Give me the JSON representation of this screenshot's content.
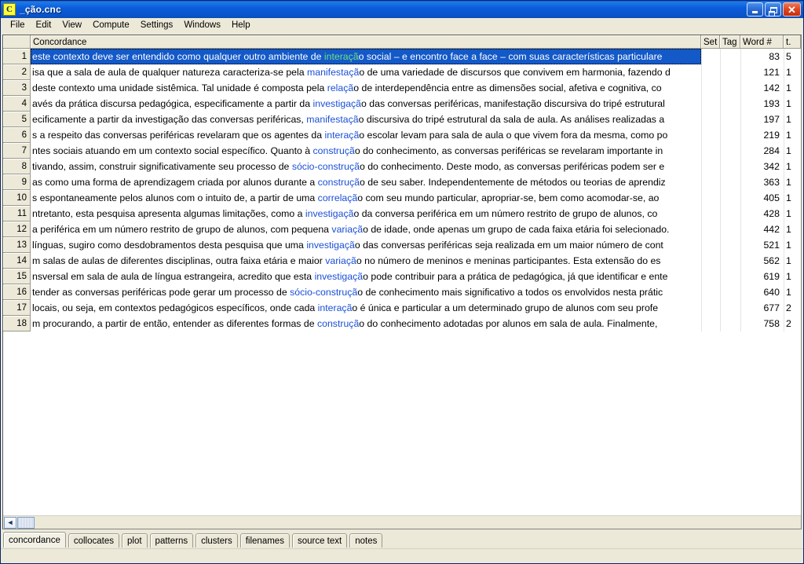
{
  "window": {
    "title": "_ção.cnc",
    "icon": "antconc-c-icon",
    "minimize_label": "",
    "restore_label": "",
    "close_label": "✕"
  },
  "menu": {
    "items": [
      {
        "label": "File"
      },
      {
        "label": "Edit"
      },
      {
        "label": "View"
      },
      {
        "label": "Compute"
      },
      {
        "label": "Settings"
      },
      {
        "label": "Windows"
      },
      {
        "label": "Help"
      }
    ]
  },
  "table": {
    "headers": {
      "index": "",
      "concordance": "Concordance",
      "set": "Set",
      "tag": "Tag",
      "word": "Word #",
      "last": "t. "
    },
    "rows": [
      {
        "index": "1",
        "pre": "este contexto deve ser entendido como qualquer outro ambiente de ",
        "kw": "interaçã",
        "post": "o social – e encontro face a face – com suas características particulare",
        "set": "",
        "tag": "",
        "word": "83",
        "last": "5",
        "selected": true
      },
      {
        "index": "2",
        "pre": "isa que a sala de aula de qualquer natureza caracteriza-se pela ",
        "kw": "manifestaçã",
        "post": "o de uma variedade de discursos que convivem em harmonia, fazendo d",
        "set": "",
        "tag": "",
        "word": "121",
        "last": "1",
        "selected": false
      },
      {
        "index": "3",
        "pre": " deste contexto uma unidade sistêmica. Tal unidade é composta pela ",
        "kw": "relaçã",
        "post": "o de interdependência entre as dimensões social, afetiva e cognitiva, co",
        "set": "",
        "tag": "",
        "word": "142",
        "last": "1",
        "selected": false
      },
      {
        "index": "4",
        "pre": "avés da prática discursa pedagógica, especificamente a partir da ",
        "kw": "investigaçã",
        "post": "o das conversas periféricas, manifestação discursiva do tripé estrutural",
        "set": "",
        "tag": "",
        "word": "193",
        "last": "1",
        "selected": false
      },
      {
        "index": "5",
        "pre": "ecificamente a partir da investigação das conversas periféricas, ",
        "kw": "manifestaçã",
        "post": "o discursiva do tripé estrutural da sala de aula. As análises realizadas a",
        "set": "",
        "tag": "",
        "word": "197",
        "last": "1",
        "selected": false
      },
      {
        "index": "6",
        "pre": " s a respeito das conversas periféricas revelaram que os agentes da ",
        "kw": "interaçã",
        "post": "o escolar levam para sala de aula o que vivem fora da mesma, como po",
        "set": "",
        "tag": "",
        "word": "219",
        "last": "1",
        "selected": false
      },
      {
        "index": "7",
        "pre": "ntes sociais atuando em um contexto social específico. Quanto à ",
        "kw": "construçã",
        "post": "o do conhecimento, as conversas periféricas se revelaram importante in",
        "set": "",
        "tag": "",
        "word": "284",
        "last": "1",
        "selected": false
      },
      {
        "index": "8",
        "pre": "tivando, assim, construir significativamente seu processo de ",
        "kw": "sócio-construçã",
        "post": "o do conhecimento. Deste modo, as conversas periféricas podem ser e",
        "set": "",
        "tag": "",
        "word": "342",
        "last": "1",
        "selected": false
      },
      {
        "index": "9",
        "pre": "as como uma forma de aprendizagem criada por alunos durante a ",
        "kw": "construçã",
        "post": "o de seu saber. Independentemente de métodos ou teorias de aprendiz",
        "set": "",
        "tag": "",
        "word": "363",
        "last": "1",
        "selected": false
      },
      {
        "index": "10",
        "pre": "s espontaneamente pelos alunos com o intuito de, a partir de uma ",
        "kw": "correlaçã",
        "post": "o com seu mundo particular, apropriar-se, bem como acomodar-se, ao",
        "set": "",
        "tag": "",
        "word": "405",
        "last": "1",
        "selected": false
      },
      {
        "index": "11",
        "pre": " ntretanto, esta pesquisa apresenta algumas limitações, como a ",
        "kw": "investigaçã",
        "post": "o da conversa periférica em um número restrito de grupo de alunos, co",
        "set": "",
        "tag": "",
        "word": "428",
        "last": "1",
        "selected": false
      },
      {
        "index": "12",
        "pre": "a periférica em um número restrito de grupo de alunos, com pequena ",
        "kw": "variaçã",
        "post": "o de idade, onde apenas um grupo de cada faixa etária foi selecionado.",
        "set": "",
        "tag": "",
        "word": "442",
        "last": "1",
        "selected": false
      },
      {
        "index": "13",
        "pre": " línguas, sugiro como desdobramentos desta pesquisa que uma ",
        "kw": "investigaçã",
        "post": "o das conversas periféricas seja realizada em um maior número de cont",
        "set": "",
        "tag": "",
        "word": "521",
        "last": "1",
        "selected": false
      },
      {
        "index": "14",
        "pre": "m salas de aulas de diferentes disciplinas, outra faixa etária e maior ",
        "kw": "variaçã",
        "post": "o no número de meninos e meninas participantes. Esta extensão do es",
        "set": "",
        "tag": "",
        "word": "562",
        "last": "1",
        "selected": false
      },
      {
        "index": "15",
        "pre": "nsversal em sala de aula de língua estrangeira, acredito que esta ",
        "kw": "investigaçã",
        "post": "o pode contribuir para a prática de pedagógica, já que identificar e ente",
        "set": "",
        "tag": "",
        "word": "619",
        "last": "1",
        "selected": false
      },
      {
        "index": "16",
        "pre": " tender as conversas periféricas pode gerar um processo de ",
        "kw": "sócio-construçã",
        "post": "o de conhecimento mais significativo a todos os envolvidos nesta prátic",
        "set": "",
        "tag": "",
        "word": "640",
        "last": "1",
        "selected": false
      },
      {
        "index": "17",
        "pre": " locais, ou seja, em contextos pedagógicos específicos, onde cada ",
        "kw": "interaçã",
        "post": "o é única e particular a um determinado grupo de alunos com seu profe",
        "set": "",
        "tag": "",
        "word": "677",
        "last": "2",
        "selected": false
      },
      {
        "index": "18",
        "pre": "m procurando, a partir de então, entender as diferentes formas de ",
        "kw": "construçã",
        "post": "o do conhecimento adotadas por alunos em sala de aula.  Finalmente,",
        "set": "",
        "tag": "",
        "word": "758",
        "last": "2",
        "selected": false
      }
    ]
  },
  "hscroll": {
    "left_arrow": "◄",
    "thumb": ""
  },
  "tabs": [
    {
      "label": "concordance",
      "active": true
    },
    {
      "label": "collocates",
      "active": false
    },
    {
      "label": "plot",
      "active": false
    },
    {
      "label": "patterns",
      "active": false
    },
    {
      "label": "clusters",
      "active": false
    },
    {
      "label": "filenames",
      "active": false
    },
    {
      "label": "source text",
      "active": false
    },
    {
      "label": "notes",
      "active": false
    }
  ],
  "colors": {
    "titlebar_blue": "#0b5ddb",
    "selection_blue": "#1359c8",
    "keyword_blue": "#1a4fd6",
    "keyword_selected_green": "#6fe07f",
    "chrome_beige": "#ece9d8"
  }
}
